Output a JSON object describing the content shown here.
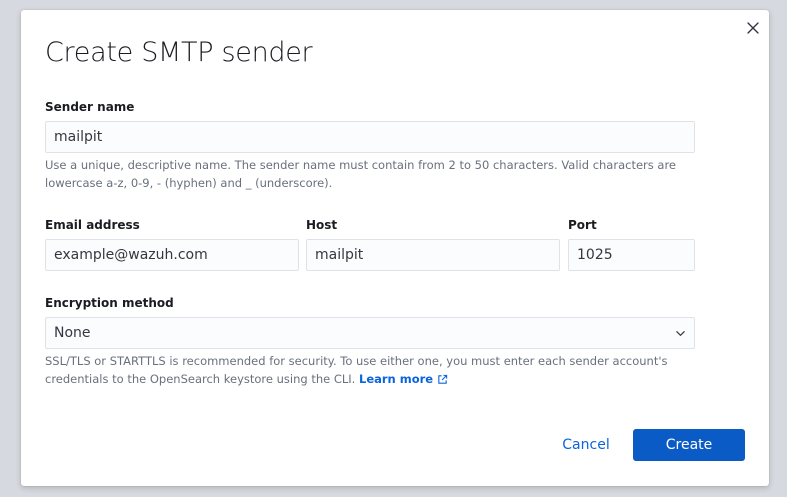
{
  "modal": {
    "title": "Create SMTP sender"
  },
  "sender_name": {
    "label": "Sender name",
    "value": "mailpit",
    "help": "Use a unique, descriptive name. The sender name must contain from 2 to 50 characters. Valid characters are lowercase a-z, 0-9, - (hyphen) and _ (underscore)."
  },
  "email": {
    "label": "Email address",
    "value": "example@wazuh.com"
  },
  "host": {
    "label": "Host",
    "value": "mailpit"
  },
  "port": {
    "label": "Port",
    "value": "1025"
  },
  "encryption": {
    "label": "Encryption method",
    "selected": "None",
    "help": "SSL/TLS or STARTTLS is recommended for security. To use either one, you must enter each sender account's credentials to the OpenSearch keystore using the CLI.",
    "learn_more": "Learn more"
  },
  "footer": {
    "cancel_label": "Cancel",
    "create_label": "Create"
  },
  "icons": {
    "close": "close-icon",
    "chevron": "chevron-down-icon",
    "external": "external-link-icon"
  },
  "colors": {
    "primary": "#0b5bc7",
    "link": "#0b64dd",
    "help_text": "#69707d"
  }
}
